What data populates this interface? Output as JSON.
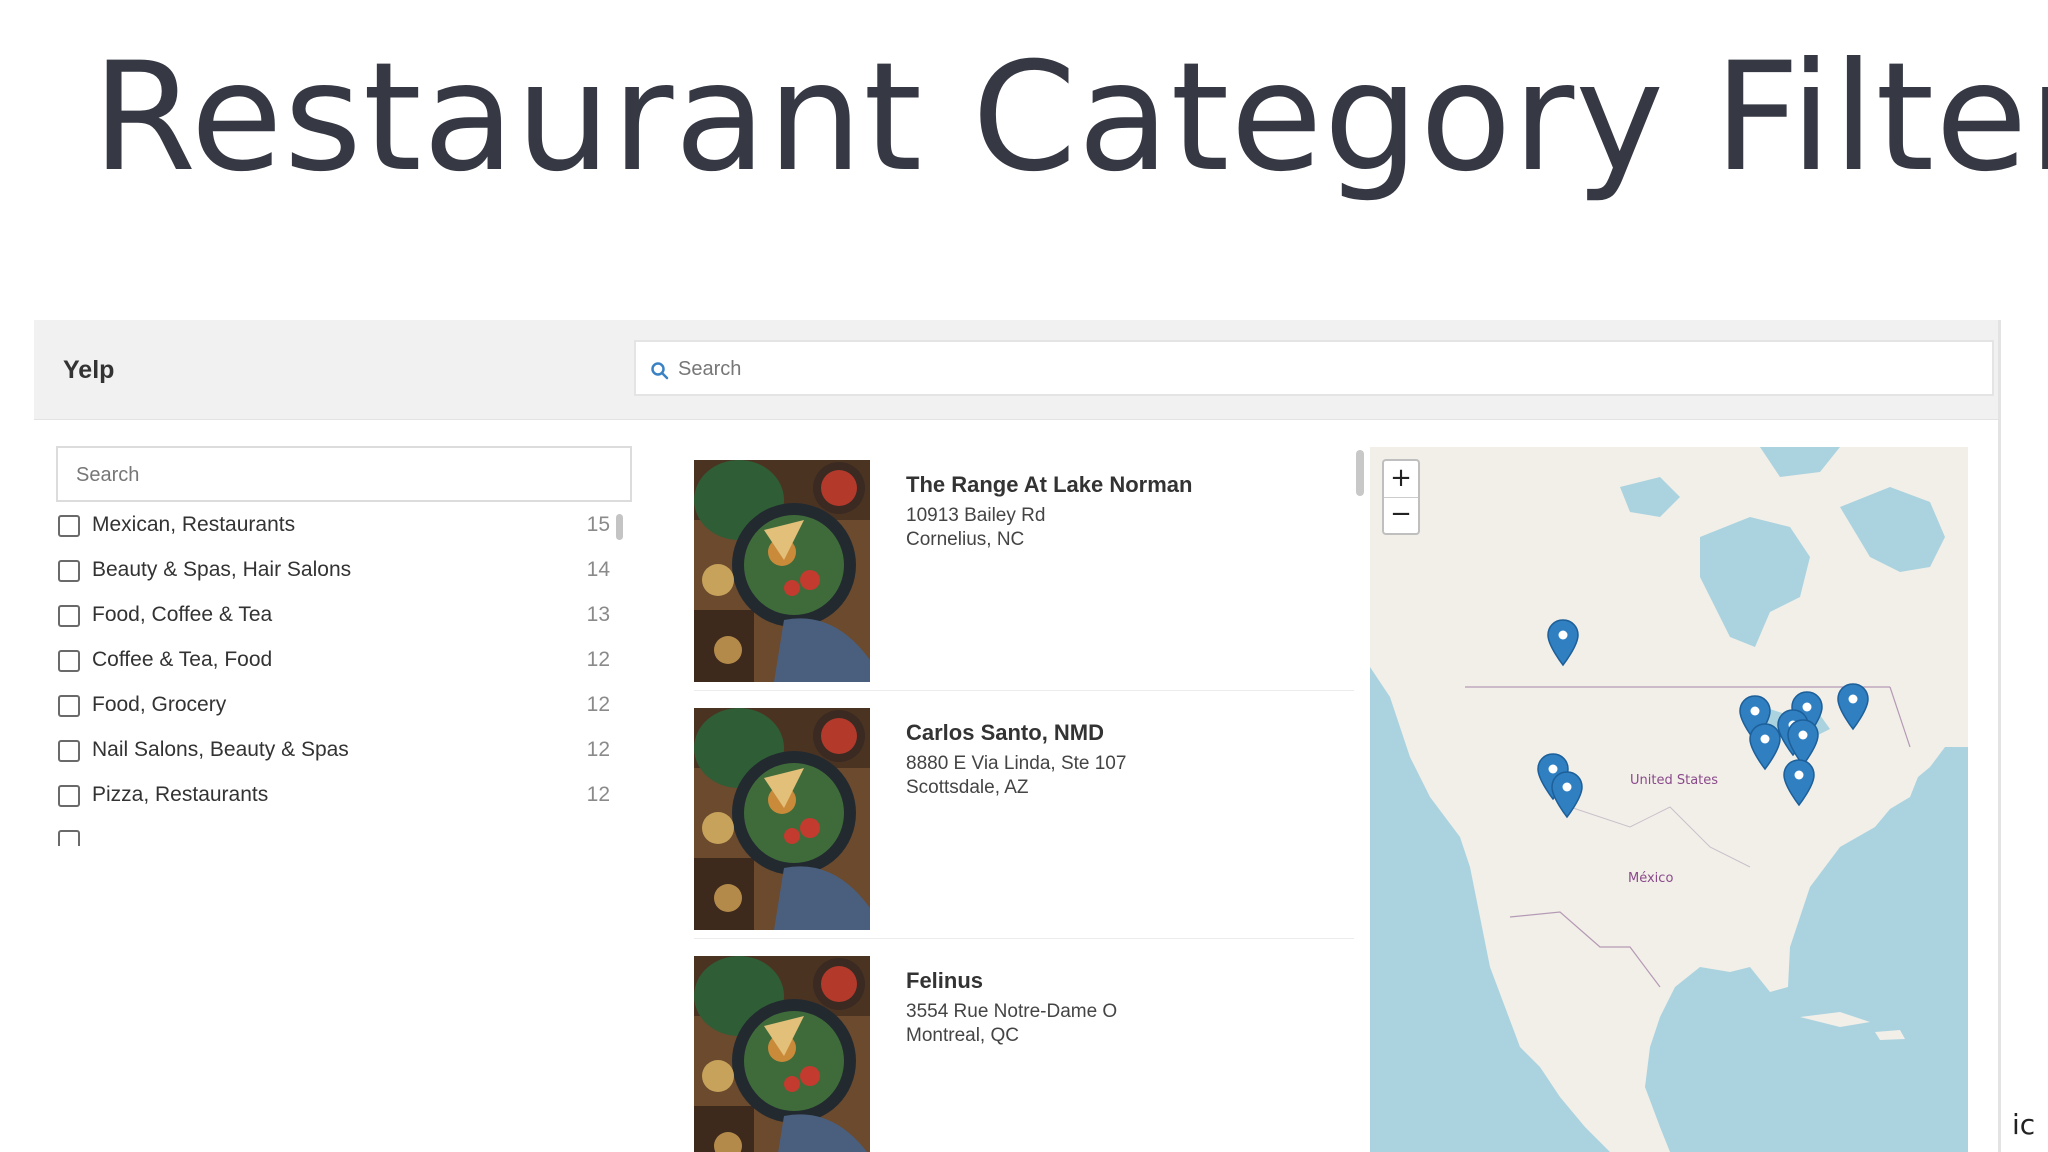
{
  "slide": {
    "title": "Restaurant Category Filter",
    "corner_text": "ic"
  },
  "app": {
    "brand": "Yelp",
    "search": {
      "placeholder": "Search"
    }
  },
  "facets": {
    "search_placeholder": "Search",
    "items": [
      {
        "label": "Mexican, Restaurants",
        "count": "15"
      },
      {
        "label": "Beauty & Spas, Hair Salons",
        "count": "14"
      },
      {
        "label": "Food, Coffee & Tea",
        "count": "13"
      },
      {
        "label": "Coffee & Tea, Food",
        "count": "12"
      },
      {
        "label": "Food, Grocery",
        "count": "12"
      },
      {
        "label": "Nail Salons, Beauty & Spas",
        "count": "12"
      },
      {
        "label": "Pizza, Restaurants",
        "count": "12"
      }
    ]
  },
  "results": [
    {
      "name": "The Range At Lake Norman",
      "address": "10913 Bailey Rd",
      "city": "Cornelius, NC"
    },
    {
      "name": "Carlos Santo, NMD",
      "address": "8880 E Via Linda, Ste 107",
      "city": "Scottsdale, AZ"
    },
    {
      "name": "Felinus",
      "address": "3554 Rue Notre-Dame O",
      "city": "Montreal, QC"
    }
  ],
  "map": {
    "zoom_in": "+",
    "zoom_out": "−",
    "labels": {
      "us": "United States",
      "mexico": "México"
    },
    "colors": {
      "water": "#aad3df",
      "land": "#f2efe9",
      "marker": "#2f7fc1"
    }
  }
}
